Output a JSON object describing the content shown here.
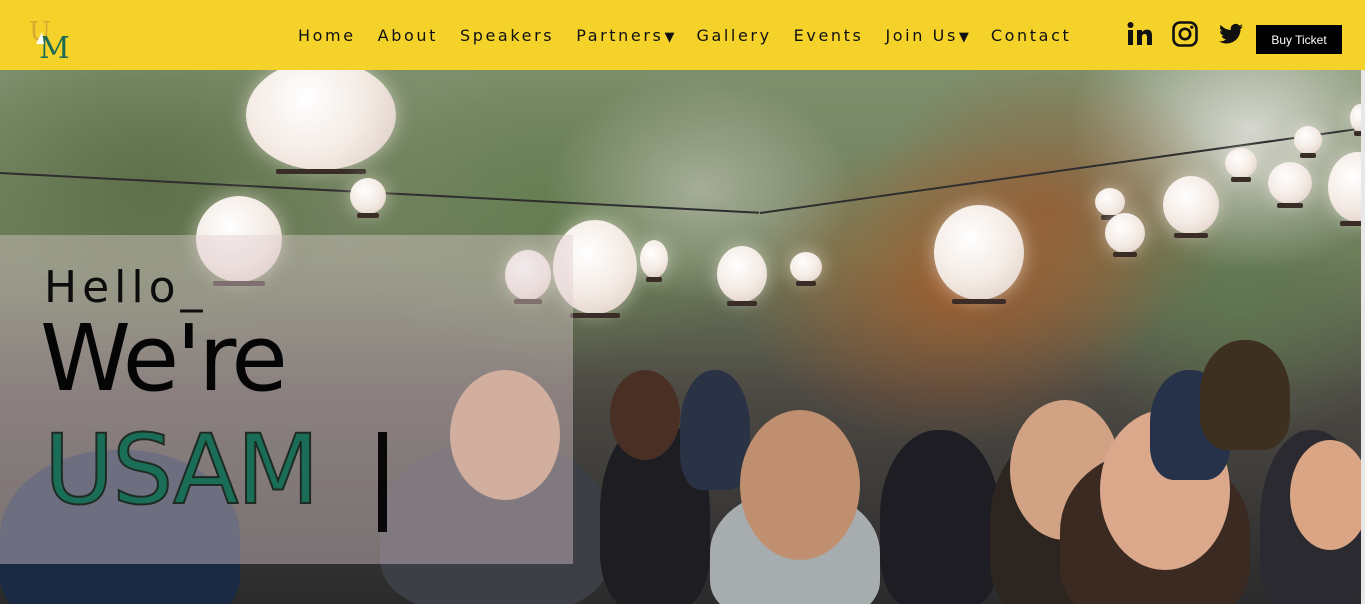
{
  "brand": {
    "logo_text": "UM",
    "colors": {
      "header_bg": "#f4d22a",
      "logo_gold": "#d4a932",
      "logo_green": "#1b6b56",
      "accent_green": "#1a6e58",
      "button_bg": "#000000"
    }
  },
  "nav": {
    "items": [
      {
        "label": "Home",
        "has_dropdown": false
      },
      {
        "label": "About",
        "has_dropdown": false
      },
      {
        "label": "Speakers",
        "has_dropdown": false
      },
      {
        "label": "Partners",
        "has_dropdown": true
      },
      {
        "label": "Gallery",
        "has_dropdown": false
      },
      {
        "label": "Events",
        "has_dropdown": false
      },
      {
        "label": "Join Us",
        "has_dropdown": true
      },
      {
        "label": "Contact",
        "has_dropdown": false
      }
    ],
    "dropdown_glyph": "▼"
  },
  "social": [
    {
      "icon": "linkedin-icon"
    },
    {
      "icon": "instagram-icon"
    },
    {
      "icon": "twitter-icon"
    }
  ],
  "cta": {
    "buy_label": "Buy Ticket"
  },
  "hero": {
    "line1": "Hello_",
    "line2": "We're",
    "line3": "USAM",
    "image_subject": "outdoor party crowd under paper lanterns"
  }
}
